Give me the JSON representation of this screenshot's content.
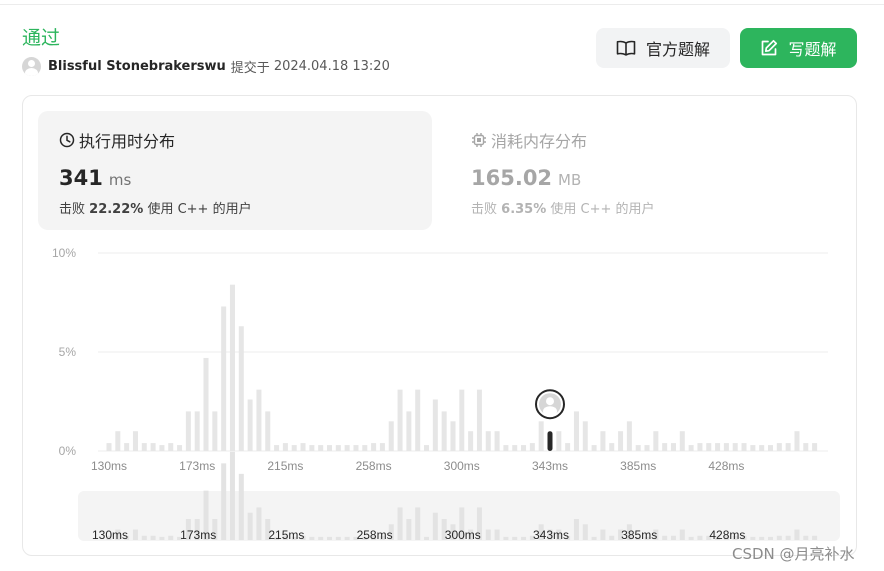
{
  "submission": {
    "status": "通过",
    "username": "Blissful Stonebrakerswu",
    "submitted_label": "提交于",
    "submitted_time": "2024.04.18 13:20"
  },
  "buttons": {
    "official_solution": "官方题解",
    "write_solution": "写题解"
  },
  "runtime": {
    "title": "执行用时分布",
    "value": "341",
    "unit": "ms",
    "beat_prefix": "击败",
    "beat_percent": "22.22%",
    "beat_suffix": "使用 C++ 的用户"
  },
  "memory": {
    "title": "消耗内存分布",
    "value": "165.02",
    "unit": "MB",
    "beat_prefix": "击败",
    "beat_percent": "6.35%",
    "beat_suffix": "使用 C++ 的用户"
  },
  "chart_data": {
    "type": "bar",
    "title": "",
    "xlabel": "",
    "ylabel": "",
    "ylim": [
      0,
      10
    ],
    "y_ticks": [
      "0%",
      "5%",
      "10%"
    ],
    "x_tick_labels": [
      "130ms",
      "173ms",
      "215ms",
      "258ms",
      "300ms",
      "343ms",
      "385ms",
      "428ms"
    ],
    "grid": true,
    "highlight_index": 50,
    "values": [
      0.4,
      1.0,
      0.4,
      1.0,
      0.4,
      0.4,
      0.3,
      0.4,
      0.3,
      2.0,
      2.0,
      4.7,
      2.0,
      7.3,
      8.4,
      6.3,
      2.6,
      3.1,
      2.0,
      0.3,
      0.4,
      0.3,
      0.4,
      0.3,
      0.3,
      0.3,
      0.3,
      0.3,
      0.3,
      0.3,
      0.4,
      0.4,
      1.5,
      3.1,
      2.0,
      3.1,
      0.3,
      2.6,
      2.0,
      1.5,
      3.1,
      1.0,
      3.1,
      1.0,
      1.0,
      0.3,
      0.3,
      0.3,
      0.4,
      1.5,
      1.0,
      1.0,
      0.4,
      2.0,
      1.5,
      0.3,
      1.0,
      0.4,
      1.0,
      1.5,
      0.3,
      0.3,
      1.0,
      0.4,
      0.4,
      1.0,
      0.3,
      0.4,
      0.4,
      0.4,
      0.4,
      0.4,
      0.4,
      0.3,
      0.3,
      0.3,
      0.4,
      0.4,
      1.0,
      0.4,
      0.4
    ]
  },
  "watermark": "CSDN @月亮补水"
}
